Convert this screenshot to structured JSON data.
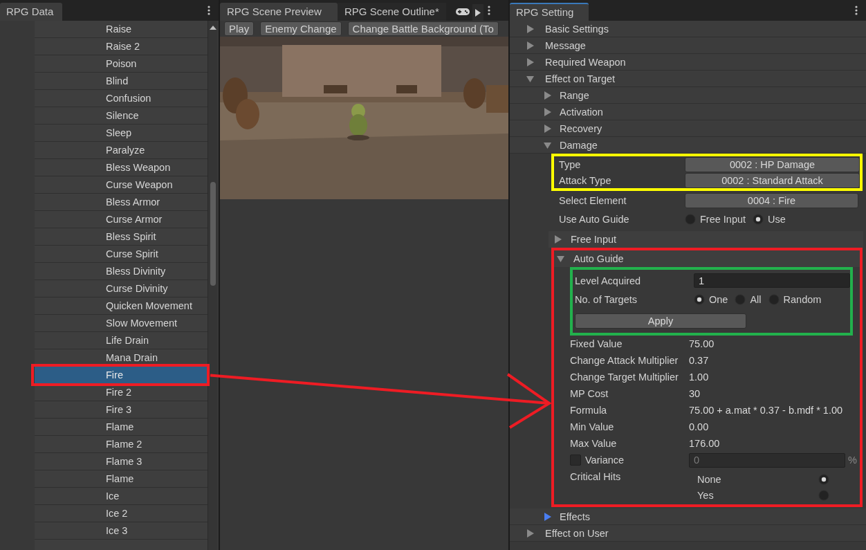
{
  "data_panel": {
    "tab": "RPG Data",
    "items": [
      {
        "label": "Raise",
        "selected": false
      },
      {
        "label": "Raise 2",
        "selected": false
      },
      {
        "label": "Poison",
        "selected": false
      },
      {
        "label": "Blind",
        "selected": false
      },
      {
        "label": "Confusion",
        "selected": false
      },
      {
        "label": "Silence",
        "selected": false
      },
      {
        "label": "Sleep",
        "selected": false
      },
      {
        "label": "Paralyze",
        "selected": false
      },
      {
        "label": "Bless Weapon",
        "selected": false
      },
      {
        "label": "Curse Weapon",
        "selected": false
      },
      {
        "label": "Bless Armor",
        "selected": false
      },
      {
        "label": "Curse Armor",
        "selected": false
      },
      {
        "label": "Bless Spirit",
        "selected": false
      },
      {
        "label": "Curse Spirit",
        "selected": false
      },
      {
        "label": "Bless Divinity",
        "selected": false
      },
      {
        "label": "Curse Divinity",
        "selected": false
      },
      {
        "label": "Quicken Movement",
        "selected": false
      },
      {
        "label": "Slow Movement",
        "selected": false
      },
      {
        "label": "Life Drain",
        "selected": false
      },
      {
        "label": "Mana Drain",
        "selected": false
      },
      {
        "label": "Fire",
        "selected": true,
        "color": "#ee1c24"
      },
      {
        "label": "Fire 2",
        "selected": false
      },
      {
        "label": "Fire 3",
        "selected": false
      },
      {
        "label": "Flame",
        "selected": false
      },
      {
        "label": "Flame 2",
        "selected": false
      },
      {
        "label": "Flame 3",
        "selected": false
      },
      {
        "label": "Flame",
        "selected": false
      },
      {
        "label": "Ice",
        "selected": false
      },
      {
        "label": "Ice 2",
        "selected": false
      },
      {
        "label": "Ice 3",
        "selected": false
      }
    ]
  },
  "preview_panel": {
    "tabs": [
      {
        "label": "RPG Scene Preview",
        "selected": true
      },
      {
        "label": "RPG Scene Outline*",
        "selected": false
      }
    ],
    "toolbar": [
      "Play",
      "Enemy Change",
      "Change Battle Background (To"
    ]
  },
  "settings_panel": {
    "tab": "RPG Setting",
    "tree": [
      {
        "label": "Basic Settings",
        "expanded": false
      },
      {
        "label": "Message",
        "expanded": false
      },
      {
        "label": "Required Weapon",
        "expanded": false
      },
      {
        "label": "Effect on Target",
        "expanded": true,
        "children": [
          {
            "label": "Range",
            "expanded": false
          },
          {
            "label": "Activation",
            "expanded": false
          },
          {
            "label": "Recovery",
            "expanded": false
          },
          {
            "label": "Damage",
            "expanded": true,
            "fields": [
              {
                "kind": "frame",
                "color": "#ffff00",
                "fields": [
                  {
                    "kind": "dropdown",
                    "label": "Type",
                    "value": "0002 : HP Damage"
                  },
                  {
                    "kind": "dropdown",
                    "label": "Attack Type",
                    "value": "0002 : Standard Attack"
                  }
                ]
              },
              {
                "kind": "dropdown",
                "label": "Select Element",
                "value": "0004 : Fire"
              },
              {
                "kind": "radio",
                "label": "Use Auto Guide",
                "options": [
                  {
                    "label": "Free Input",
                    "selected": false
                  },
                  {
                    "label": "Use",
                    "selected": true
                  }
                ]
              },
              {
                "kind": "foldout",
                "label": "Free Input",
                "expanded": false
              },
              {
                "kind": "frame",
                "color": "#ee1c24",
                "fields": [
                  {
                    "kind": "foldout",
                    "label": "Auto Guide",
                    "expanded": true,
                    "fields": [
                      {
                        "kind": "frame",
                        "color": "#22b14c",
                        "fields": [
                          {
                            "kind": "input",
                            "label": "Level Acquired",
                            "value": "1"
                          },
                          {
                            "kind": "radio",
                            "label": "No. of Targets",
                            "options": [
                              {
                                "label": "One",
                                "selected": true
                              },
                              {
                                "label": "All",
                                "selected": false
                              },
                              {
                                "label": "Random",
                                "selected": false
                              }
                            ]
                          },
                          {
                            "kind": "button",
                            "label": "Apply"
                          }
                        ]
                      },
                      {
                        "kind": "value",
                        "label": "Fixed Value",
                        "value": "75.00"
                      },
                      {
                        "kind": "value",
                        "label": "Change Attack Multiplier",
                        "value": "0.37"
                      },
                      {
                        "kind": "value",
                        "label": "Change Target Multiplier",
                        "value": "1.00"
                      },
                      {
                        "kind": "value",
                        "label": "MP Cost",
                        "value": "30"
                      },
                      {
                        "kind": "value",
                        "label": "Formula",
                        "value": "75.00 + a.mat * 0.37 - b.mdf * 1.00"
                      },
                      {
                        "kind": "value",
                        "label": "Min Value",
                        "value": "0.00"
                      },
                      {
                        "kind": "value",
                        "label": "Max Value",
                        "value": "176.00"
                      },
                      {
                        "kind": "toggle_input",
                        "label": "Variance",
                        "checked": false,
                        "value": "0",
                        "disabled": true,
                        "unit": "%"
                      },
                      {
                        "kind": "radio_column",
                        "label": "Critical Hits",
                        "options": [
                          {
                            "label": "None",
                            "selected": true
                          },
                          {
                            "label": "Yes",
                            "selected": false
                          }
                        ]
                      }
                    ]
                  }
                ]
              }
            ]
          },
          {
            "label": "Effects",
            "expanded": false,
            "highlighted": true
          }
        ]
      },
      {
        "label": "Effect on User",
        "expanded": false
      }
    ]
  },
  "annotations": [
    {
      "kind": "arrow",
      "color": "#ee1c24"
    }
  ]
}
